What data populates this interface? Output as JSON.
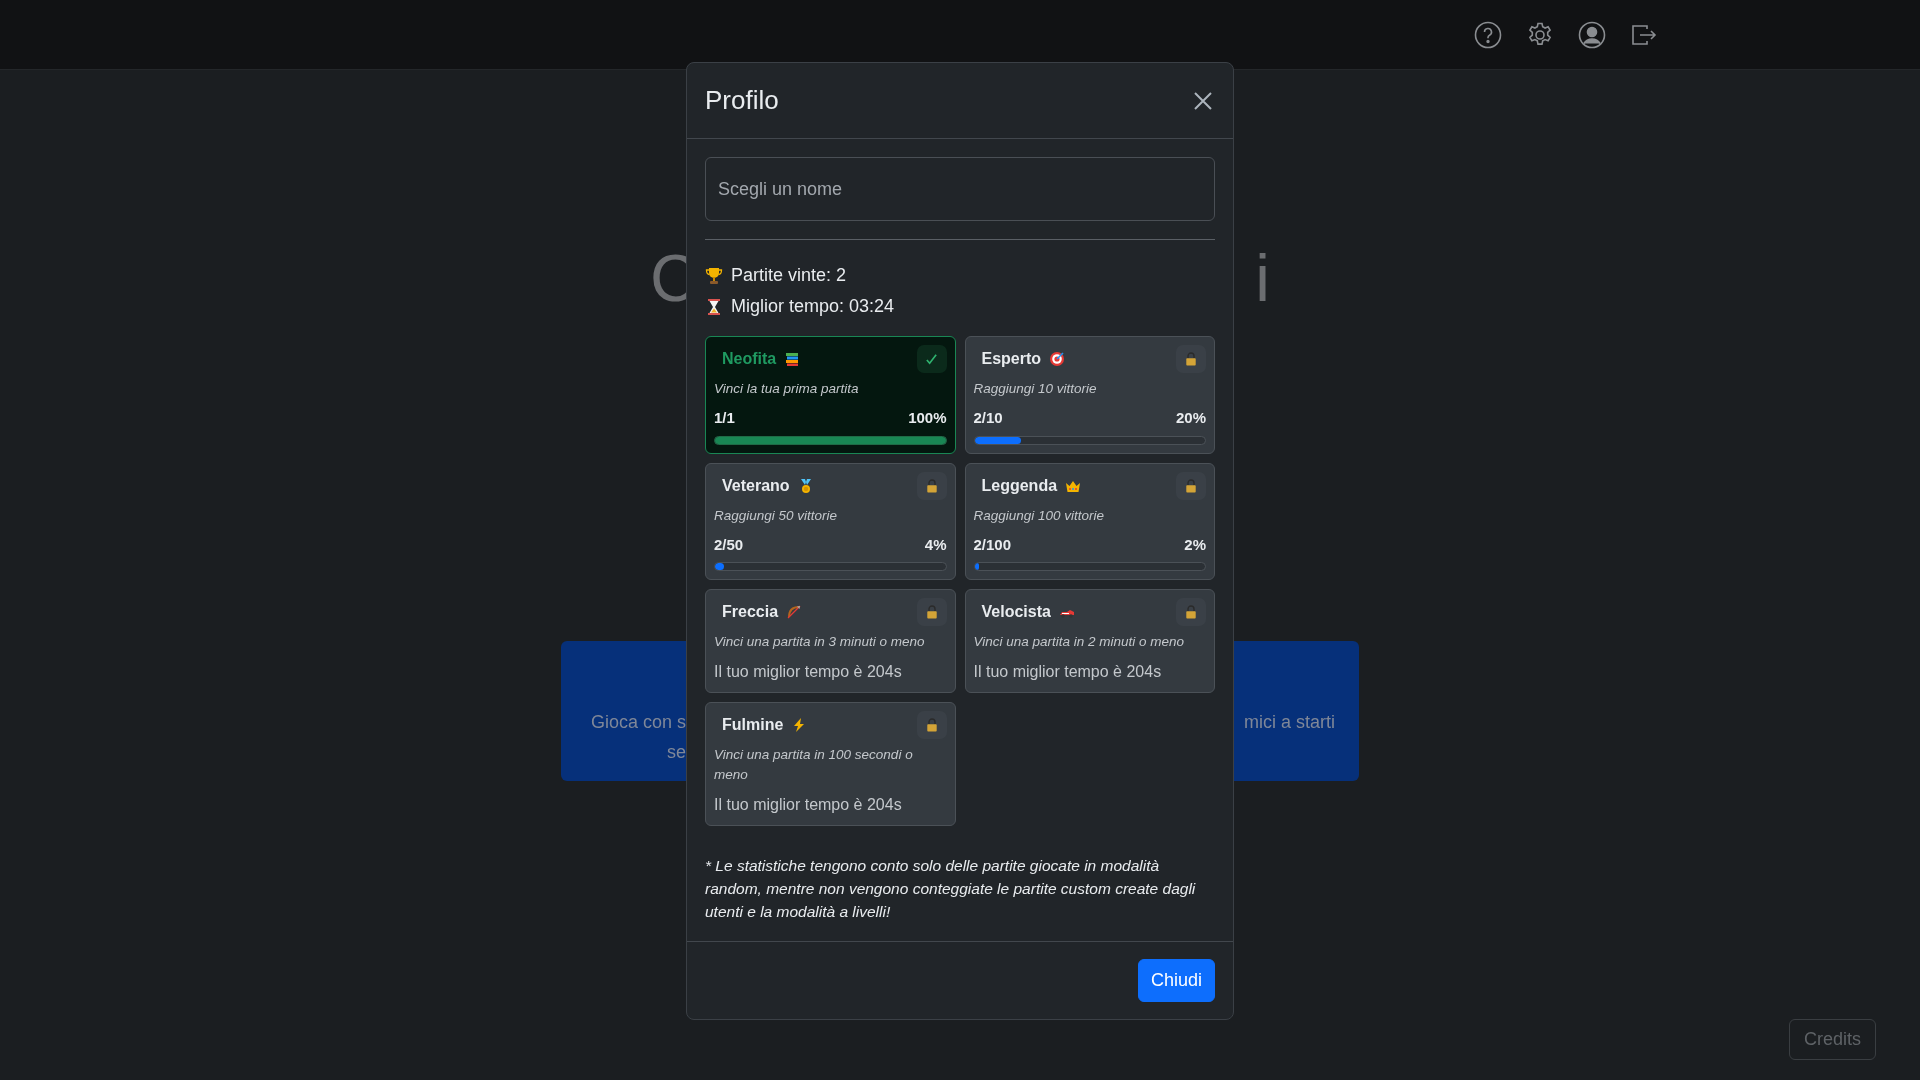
{
  "background": {
    "title_left": "C",
    "title_right": "i",
    "banner": {
      "left_lines": [
        "Gioca con s",
        "se"
      ],
      "right_lines": [
        "mici a starti"
      ]
    },
    "credits_button": "Credits"
  },
  "modal": {
    "title": "Profilo",
    "name_field": {
      "placeholder": "Scegli un nome"
    },
    "stats": [
      "Partite vinte: 2",
      "Miglior tempo: 03:24"
    ],
    "achievements": [
      {
        "kind": "progress",
        "name": "Neofita",
        "unlocked": true,
        "description": "Vinci la tua prima partita",
        "count": "1/1",
        "percent": "100%",
        "level": 1
      },
      {
        "kind": "progress",
        "name": "Esperto",
        "unlocked": false,
        "description": "Raggiungi 10 vittorie",
        "count": "2/10",
        "percent": "20%",
        "level": 0.2
      },
      {
        "kind": "progress",
        "name": "Veterano",
        "unlocked": false,
        "description": "Raggiungi 50 vittorie",
        "count": "2/50",
        "percent": "4%",
        "level": 0.04
      },
      {
        "kind": "progress",
        "name": "Leggenda",
        "unlocked": false,
        "description": "Raggiungi 100 vittorie",
        "count": "2/100",
        "percent": "2%",
        "level": 0.02
      },
      {
        "kind": "time",
        "name": "Freccia",
        "unlocked": false,
        "description": "Vinci una partita in 3 minuti o meno",
        "note": "Il tuo miglior tempo è 204s"
      },
      {
        "kind": "time",
        "name": "Velocista",
        "unlocked": false,
        "description": "Vinci una partita in 2 minuti o meno",
        "note": "Il tuo miglior tempo è 204s"
      },
      {
        "kind": "time",
        "name": "Fulmine",
        "unlocked": false,
        "description": "Vinci una partita in 100 secondi o meno",
        "note": "Il tuo miglior tempo è 204s"
      }
    ],
    "footnote": "* Le statistiche tengono conto solo delle partite giocate in modalità random, mentre non vengono conteggiate le partite custom create dagli utenti e la modalità a livelli!",
    "close_button": "Chiudi"
  }
}
